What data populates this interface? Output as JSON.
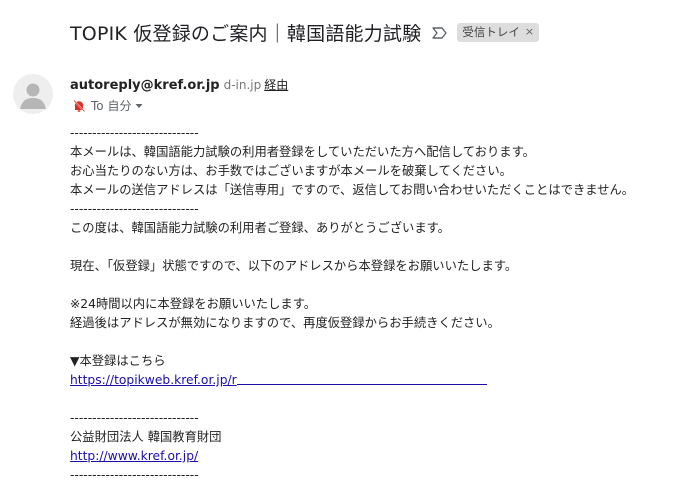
{
  "email": {
    "subject": "TOPIK 仮登録のご案内｜韓国語能力試験",
    "label": "受信トレイ",
    "label_close": "×",
    "sender_email": "autoreply@kref.or.jp",
    "sender_domain": "d-in.jp",
    "via_label": "経由",
    "to_label": "To 自分",
    "body": {
      "divider1": "-----------------------------",
      "notice1": "本メールは、韓国語能力試験の利用者登録をしていただいた方へ配信しております。",
      "notice2": "お心当たりのない方は、お手数ではございますが本メールを破棄してください。",
      "notice3": "本メールの送信アドレスは「送信専用」ですので、返信してお問い合わせいただくことはできません。",
      "divider2": "-----------------------------",
      "thanks": "この度は、韓国語能力試験の利用者ご登録、ありがとうございます。",
      "status": "現在、「仮登録」状態ですので、以下のアドレスから本登録をお願いいたします。",
      "deadline": "※24時間以内に本登録をお願いいたします。",
      "expire": "経過後はアドレスが無効になりますので、再度仮登録からお手続きください。",
      "register_heading": "▼本登録はこちら",
      "register_link": "https://topikweb.kref.or.jp/r",
      "divider3": "-----------------------------",
      "org": "公益財団法人 韓国教育財団",
      "org_link": "http://www.kref.or.jp/",
      "divider4": "-----------------------------"
    }
  },
  "icons": {
    "important": "important-marker-icon",
    "avatar": "person-avatar-icon",
    "to_marker": "muted-bell-icon",
    "dropdown": "caret-down-icon"
  },
  "colors": {
    "link": "#1a0dab",
    "chip_bg": "#dddddd",
    "to_marker": "#d93025"
  }
}
